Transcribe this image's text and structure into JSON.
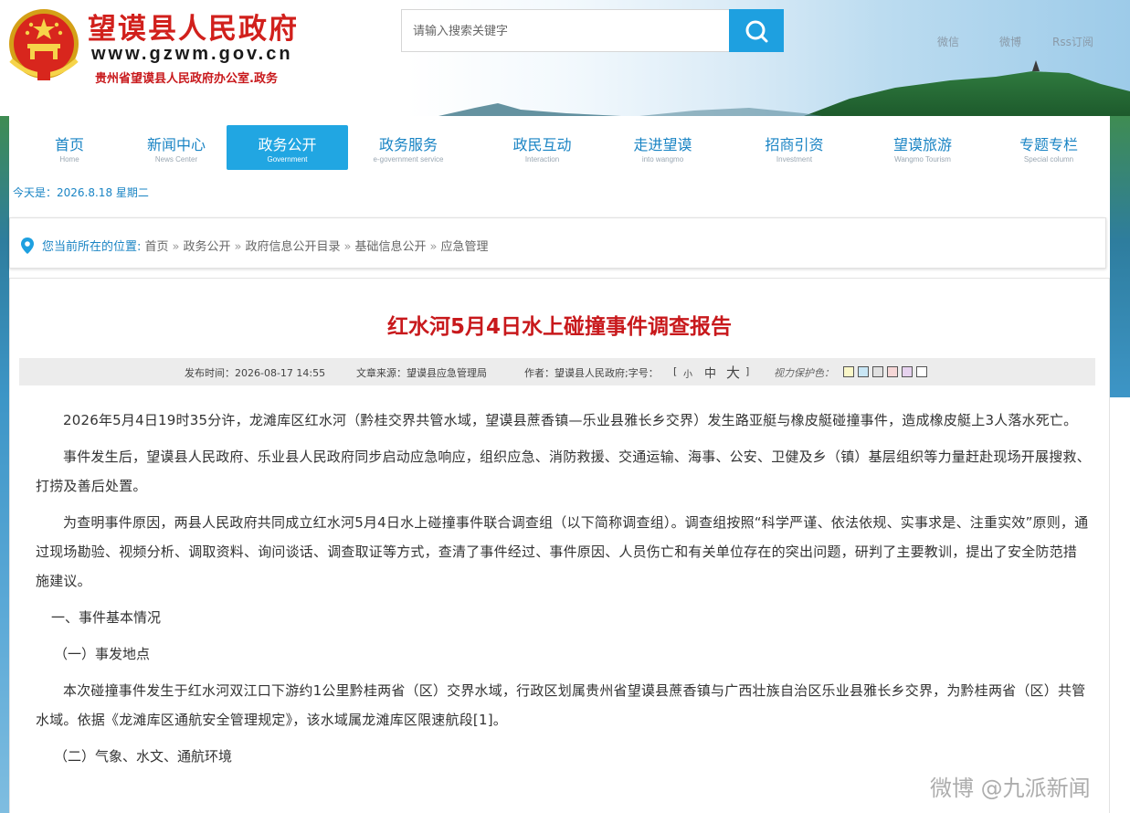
{
  "header": {
    "site_name": "望谟县人民政府",
    "site_url": "www.gzwm.gov.cn",
    "site_sub": "贵州省望谟县人民政府办公室.政务"
  },
  "search": {
    "placeholder": "请输入搜索关键字"
  },
  "social": {
    "wechat": "微信",
    "weibo": "微博",
    "rss": "Rss订阅"
  },
  "nav": {
    "items": [
      {
        "cn": "首页",
        "en": "Home"
      },
      {
        "cn": "新闻中心",
        "en": "News Center"
      },
      {
        "cn": "政务公开",
        "en": "Government"
      },
      {
        "cn": "政务服务",
        "en": "e-government service"
      },
      {
        "cn": "政民互动",
        "en": "Interaction"
      },
      {
        "cn": "走进望谟",
        "en": "into wangmo"
      },
      {
        "cn": "招商引资",
        "en": "Investment"
      },
      {
        "cn": "望谟旅游",
        "en": "Wangmo Tourism"
      },
      {
        "cn": "专题专栏",
        "en": "Special column"
      }
    ],
    "active_index": 2
  },
  "date_text": "今天是：2026.8.18 星期二",
  "breadcrumb": {
    "label": "您当前所在的位置:",
    "items": [
      "首页",
      "政务公开",
      "政府信息公开目录",
      "基础信息公开",
      "应急管理"
    ],
    "separator": "»"
  },
  "article": {
    "title": "红水河5月4日水上碰撞事件调查报告",
    "meta": {
      "publish_time": "发布时间：2026-08-17 14:55",
      "source": "文章来源：望谟县应急管理局",
      "author": "作者：望谟县人民政府;字号：",
      "bracket_open": "[",
      "font_small": "小",
      "font_medium": "中",
      "font_large": "大",
      "bracket_close": "]",
      "eye_label": "视力保护色："
    },
    "eye_colors": [
      "#faf7c8",
      "#c8e6f5",
      "#e0e0e0",
      "#f5d6d6",
      "#e6d2ee",
      "#ffffff"
    ],
    "paragraphs": [
      "2026年5月4日19时35分许，龙滩库区红水河（黔桂交界共管水域，望谟县蔗香镇—乐业县雅长乡交界）发生路亚艇与橡皮艇碰撞事件，造成橡皮艇上3人落水死亡。",
      "事件发生后，望谟县人民政府、乐业县人民政府同步启动应急响应，组织应急、消防救援、交通运输、海事、公安、卫健及乡（镇）基层组织等力量赶赴现场开展搜救、打捞及善后处置。",
      "为查明事件原因，两县人民政府共同成立红水河5月4日水上碰撞事件联合调查组（以下简称调查组）。调查组按照“科学严谨、依法依规、实事求是、注重实效”原则，通过现场勘验、视频分析、调取资料、询问谈话、调查取证等方式，查清了事件经过、事件原因、人员伤亡和有关单位存在的突出问题，研判了主要教训，提出了安全防范措施建议。"
    ],
    "heading1": "一、事件基本情况",
    "heading1_1": "（一）事发地点",
    "paragraph4": "本次碰撞事件发生于红水河双江口下游约1公里黔桂两省（区）交界水域，行政区划属贵州省望谟县蔗香镇与广西壮族自治区乐业县雅长乡交界，为黔桂两省（区）共管水域。依据《龙滩库区通航安全管理规定》，该水域属龙滩库区限速航段[1]。",
    "heading1_2": "（二）气象、水文、通航环境"
  },
  "watermark": "微博 @九派新闻",
  "colors": {
    "accent": "#1ea0e0",
    "nav_active": "#21a6e2",
    "title_red": "#c8191c",
    "link_blue": "#1a84c4"
  }
}
